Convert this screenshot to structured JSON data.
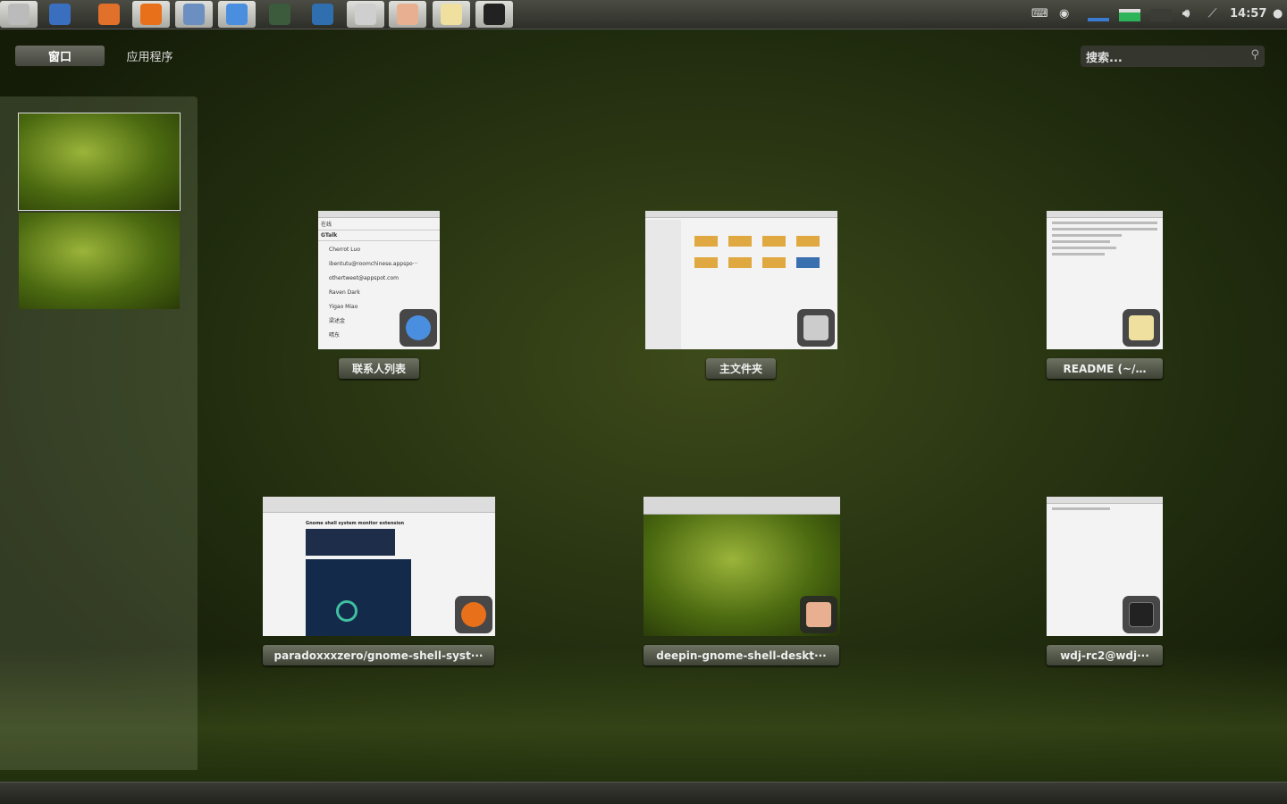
{
  "topbar": {
    "launchers": [
      {
        "name": "activities-icon",
        "color": "#bbbbbb"
      },
      {
        "name": "text-editor-icon",
        "color": "#3a6fc0"
      },
      {
        "name": "color-wheel-icon",
        "color": "#e0702a"
      },
      {
        "name": "firefox-icon",
        "color": "#e8701a"
      },
      {
        "name": "mail-icon",
        "color": "#6a8fc0"
      },
      {
        "name": "chat-icon",
        "color": "#4a8ee0"
      },
      {
        "name": "camera-icon",
        "color": "#3c5a3c"
      },
      {
        "name": "document-viewer-icon",
        "color": "#2f6fb0"
      },
      {
        "name": "file-cabinet-icon",
        "color": "#cfcfcf"
      },
      {
        "name": "eye-of-gnome-icon",
        "color": "#e8b090"
      },
      {
        "name": "gedit-icon",
        "color": "#f0e0a0"
      },
      {
        "name": "terminal-icon",
        "color": "#222222"
      }
    ],
    "clock": "14:57"
  },
  "tabs": {
    "windows": "窗口",
    "applications": "应用程序"
  },
  "search": {
    "placeholder": "搜索..."
  },
  "windows": [
    {
      "label": "联系人列表",
      "app": "chat",
      "contacts": [
        "Cherrot Luo",
        "ibentutu@roomchinese.appspo···",
        "othertweet@appspot.com",
        "Raven Dark",
        "Yigao Miao",
        "梁述金",
        "晴东"
      ],
      "status": "在线",
      "account": "GTalk"
    },
    {
      "label": "主文件夹",
      "app": "files"
    },
    {
      "label": "README (~/…",
      "app": "gedit"
    },
    {
      "label": "paradoxxxzero/gnome-shell-syst···",
      "app": "firefox",
      "page_heading": "Gnome shell system monitor extension"
    },
    {
      "label": "deepin-gnome-shell-deskt···",
      "app": "image-viewer"
    },
    {
      "label": "wdj-rc2@wdj···",
      "app": "terminal"
    }
  ]
}
